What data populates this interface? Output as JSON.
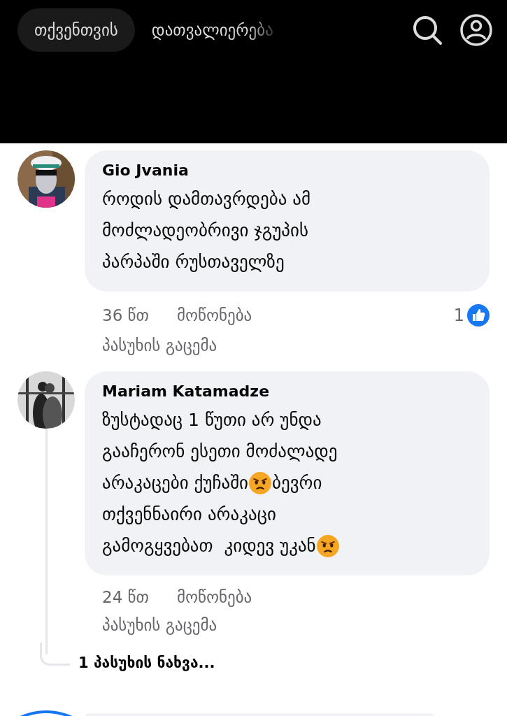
{
  "tabs": [
    {
      "label": "თქვენთვის",
      "selected": true
    },
    {
      "label": "დათვალიერება",
      "selected": false
    }
  ],
  "comments": [
    {
      "author": "Gio Jvania",
      "lines": [
        [
          {
            "kind": "text",
            "text": "როდის დამთავრდება ამ"
          }
        ],
        [
          {
            "kind": "text",
            "text": "მოძლადეობრივი ჯგუპის"
          }
        ],
        [
          {
            "kind": "text",
            "text": "პარპაში რუსთაველზე"
          }
        ]
      ],
      "time": "36 წთ",
      "like": "მოწონება",
      "reply": "პასუხის გაცემა",
      "reaction_count": "1"
    },
    {
      "author": "Mariam Katamadze",
      "lines": [
        [
          {
            "kind": "text",
            "text": "ზუსტადაც 1 წუთი არ უნდა"
          }
        ],
        [
          {
            "kind": "text",
            "text": "გააჩერონ ესეთი მოძალადე"
          }
        ],
        [
          {
            "kind": "text",
            "text": "არაკაცები ქუჩაში"
          },
          {
            "kind": "emoji"
          },
          {
            "kind": "text",
            "text": "ბევრი"
          }
        ],
        [
          {
            "kind": "text",
            "text": "თქვენნაირი არაკაცი"
          }
        ],
        [
          {
            "kind": "text",
            "text": "გამოგყვებათ  კიდევ უკან"
          },
          {
            "kind": "emoji"
          }
        ]
      ],
      "time": "24 წთ",
      "like": "მოწონება",
      "reply": "პასუხის გაცემა",
      "view_replies": "1 პასუხის ნახვა..."
    }
  ]
}
